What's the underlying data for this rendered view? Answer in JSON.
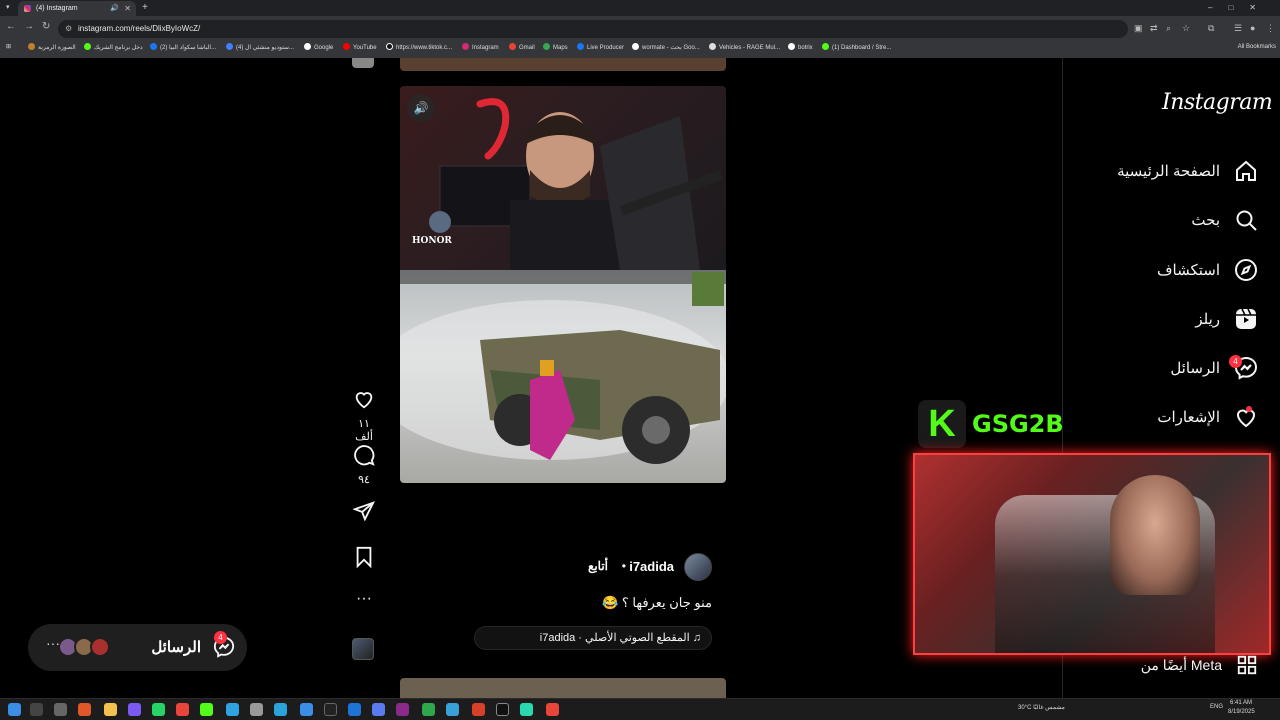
{
  "browser": {
    "tab_title": "(4) Instagram",
    "new_tab": "+",
    "url": "instagram.com/reels/DlixByIoWcZ/",
    "bookmarks": [
      "الصورة الرمزية",
      "دخل برنامج الشريك",
      "(2) الباشا سكواد البيا...",
      "(4) ستوديو منشئي ال...",
      "Google",
      "YouTube",
      "https://www.tiktok.c...",
      "Instagram",
      "Gmail",
      "Maps",
      "Live Producer",
      "wormate - بحث Goo...",
      "Vehicles - RAGE Mul...",
      "botrix",
      "(1) Dashboard / Stre..."
    ],
    "all_bookmarks": "All Bookmarks"
  },
  "sidebar": {
    "logo": "Instagram",
    "items": [
      {
        "label": "الصفحة الرئيسية",
        "icon": "home-icon"
      },
      {
        "label": "بحث",
        "icon": "search-icon"
      },
      {
        "label": "استكشاف",
        "icon": "explore-icon"
      },
      {
        "label": "ريلز",
        "icon": "reels-icon"
      },
      {
        "label": "الرسائل",
        "icon": "messenger-icon",
        "badge": "4"
      },
      {
        "label": "الإشعارات",
        "icon": "heart-icon"
      }
    ],
    "meta_more": "أيضًا من Meta"
  },
  "reel": {
    "watermark": "HONOR",
    "likes": "١١ ألف",
    "comments": "٩٤",
    "username": "i7adida",
    "separator": "•",
    "follow": "أتابع",
    "caption": "منو جان يعرفها ؟ 😂",
    "audio": "♫ المقطع الصوتي الأصلي · i7adida"
  },
  "overlay": {
    "kick_logo": "K",
    "streamer": "GSG2B"
  },
  "messages_pill": {
    "label": "الرسائل",
    "badge": "4",
    "more": "···"
  },
  "taskbar": {
    "weather": "30°C  مشمس غالبًا",
    "lang": "ENG",
    "time": "6:41 AM",
    "date": "8/19/2025"
  },
  "colors": {
    "accent_red": "#ff3040",
    "kick_green": "#53fc18",
    "background": "#000000"
  }
}
